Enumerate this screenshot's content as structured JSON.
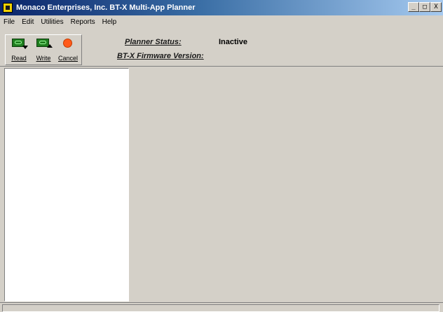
{
  "window": {
    "title": "Monaco Enterprises, Inc.  BT-X Multi-App Planner",
    "minimize_glyph": "_",
    "restore_glyph": "□",
    "close_glyph": "X"
  },
  "menu": {
    "items": [
      {
        "label": "File",
        "icon": ""
      },
      {
        "label": "Edit",
        "icon": ""
      },
      {
        "label": "Utilities",
        "icon": ""
      },
      {
        "label": "Reports",
        "icon": ""
      },
      {
        "label": "Help",
        "icon": ""
      }
    ]
  },
  "toolbar": {
    "read": {
      "label": "Read",
      "icon": "card-download-icon"
    },
    "write": {
      "label": "Write",
      "icon": "card-upload-icon"
    },
    "cancel": {
      "label": "Cancel",
      "icon": "stop-icon"
    }
  },
  "status": {
    "planner_status_label": "Planner Status:",
    "planner_status_value": "Inactive",
    "firmware_label": "BT-X Firmware Version:",
    "firmware_value": ""
  },
  "colors": {
    "title_bar_start": "#0a246a",
    "title_bar_end": "#a6caf0",
    "cancel_icon": "#ff5a1a",
    "card_icon": "#1f7d1f",
    "window_bg": "#d4d0c8"
  }
}
